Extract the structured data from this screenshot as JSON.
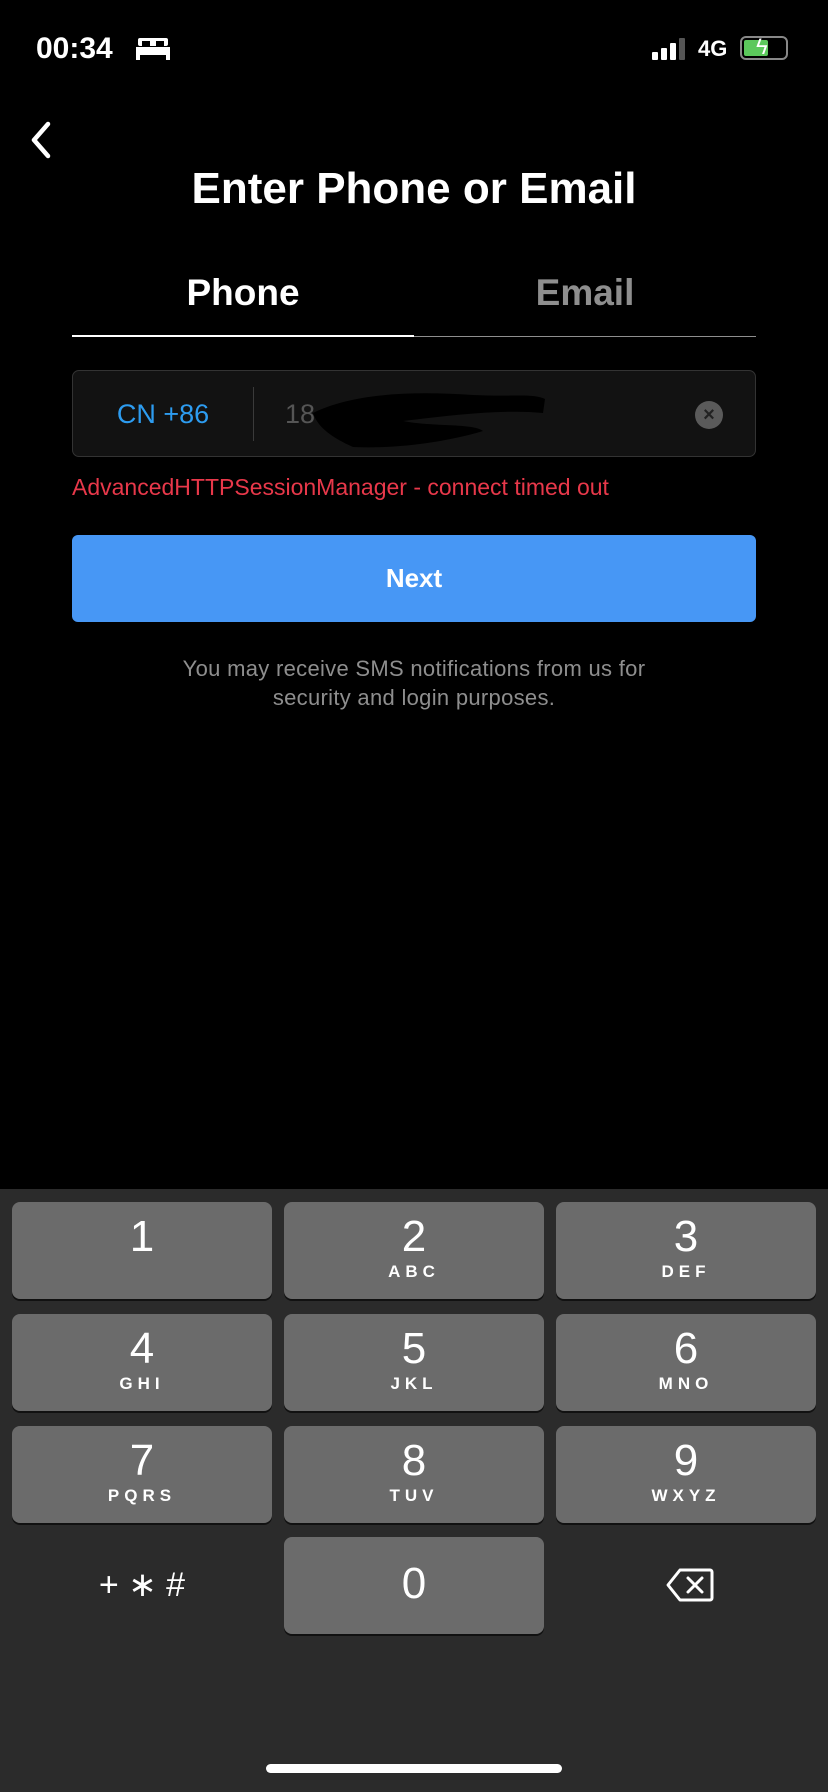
{
  "status": {
    "time": "00:34",
    "network": "4G",
    "signal_bars": 3,
    "battery_level": 0.6,
    "charging": true,
    "icons": [
      "bed-icon",
      "signal-icon",
      "battery-charging-icon"
    ]
  },
  "header": {
    "title": "Enter Phone or Email",
    "back_icon": "chevron-left-icon"
  },
  "tabs": [
    {
      "label": "Phone",
      "active": true
    },
    {
      "label": "Email",
      "active": false
    }
  ],
  "form": {
    "country_code": "CN +86",
    "phone_value": "18",
    "clear_icon": "clear-icon",
    "error": "AdvancedHTTPSessionManager - connect timed out",
    "next_label": "Next",
    "note_line1": "You may receive SMS notifications from us for",
    "note_line2": "security and login purposes."
  },
  "colors": {
    "accent": "#4797f5",
    "link": "#2d9cf0",
    "error": "#e8384a"
  },
  "keypad": [
    {
      "digit": "1",
      "letters": ""
    },
    {
      "digit": "2",
      "letters": "ABC"
    },
    {
      "digit": "3",
      "letters": "DEF"
    },
    {
      "digit": "4",
      "letters": "GHI"
    },
    {
      "digit": "5",
      "letters": "JKL"
    },
    {
      "digit": "6",
      "letters": "MNO"
    },
    {
      "digit": "7",
      "letters": "PQRS"
    },
    {
      "digit": "8",
      "letters": "TUV"
    },
    {
      "digit": "9",
      "letters": "WXYZ"
    },
    {
      "digit": "0",
      "letters": ""
    }
  ],
  "keypad_symbols": "+ ∗ #",
  "delete_icon": "backspace-icon"
}
